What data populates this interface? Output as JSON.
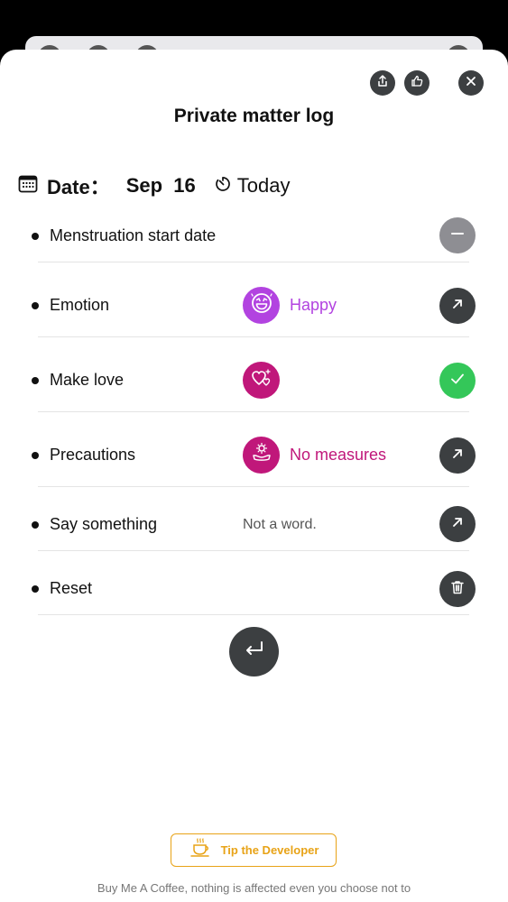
{
  "header": {
    "title": "Private matter log",
    "share_icon": "share-icon",
    "like_icon": "thumbs-up-icon",
    "close_icon": "close-icon"
  },
  "date_row": {
    "label": "Date：",
    "value": "Sep  16",
    "today_label": "Today"
  },
  "rows": [
    {
      "label": "Menstruation start date",
      "icon": "",
      "value": "",
      "action": "minus-icon"
    },
    {
      "label": "Emotion",
      "icon": "happy-face-icon",
      "value": "Happy",
      "action": "arrow-up-right-icon"
    },
    {
      "label": "Make love",
      "icon": "hearts-icon",
      "value": "",
      "action": "check-icon"
    },
    {
      "label": "Precautions",
      "icon": "no-measures-icon",
      "value": "No measures",
      "action": "arrow-up-right-icon"
    },
    {
      "label": "Say something",
      "icon": "",
      "value": "Not a word.",
      "action": "arrow-up-right-icon"
    },
    {
      "label": "Reset",
      "icon": "",
      "value": "",
      "action": "trash-icon"
    }
  ],
  "footer": {
    "tip_label": "Tip the Developer",
    "note": "Buy Me A Coffee, nothing is affected even you choose not to"
  },
  "colors": {
    "accent_purple": "#b243e0",
    "accent_magenta": "#c0177a",
    "success_green": "#34c759",
    "neutral_gray": "#8e8e93",
    "dark_button": "#3c3f41",
    "tip_orange": "#e8a317"
  }
}
